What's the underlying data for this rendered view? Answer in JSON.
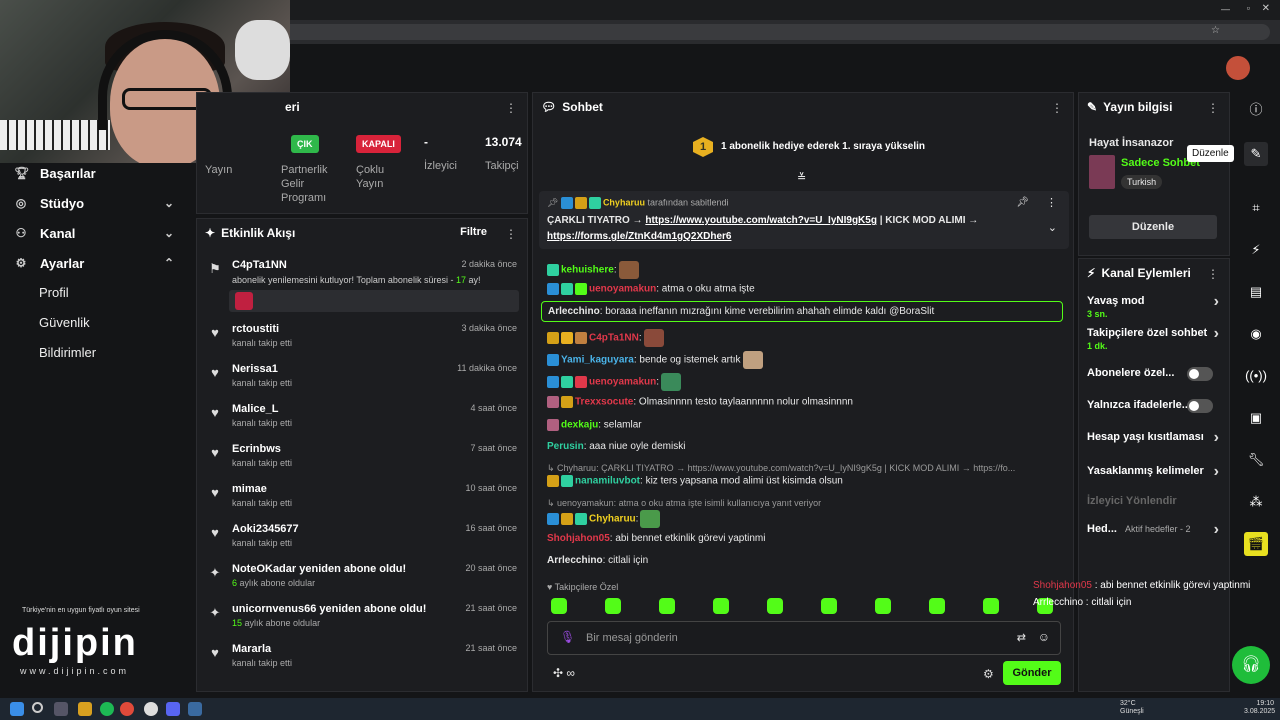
{
  "stats": {
    "header": "eri",
    "items": [
      {
        "tag": "ÇIK",
        "label": "Yayın"
      },
      {
        "tag": "",
        "label": "Partnerlik Gelir Programı"
      },
      {
        "tag": "KAPALI",
        "label": "Çoklu Yayın"
      },
      {
        "value": "-",
        "label": "İzleyici"
      },
      {
        "value": "13.074",
        "label": "Takipçi"
      }
    ]
  },
  "nav": {
    "items": [
      {
        "label": "Başarılar",
        "icon": "trophy-icon"
      },
      {
        "label": "Stüdyo",
        "icon": "studio-icon"
      },
      {
        "label": "Kanal",
        "icon": "channel-icon"
      },
      {
        "label": "Ayarlar",
        "icon": "gear-icon"
      }
    ],
    "sub": [
      "Profil",
      "Güvenlik",
      "Bildirimler"
    ]
  },
  "promo": {
    "tagline": "Türkiye'nin en uygun fiyatlı oyun sitesi",
    "logo": "dijipin",
    "url": "www.dijipin.com"
  },
  "activity": {
    "title": "Etkinlik Akışı",
    "filter": "Filtre",
    "items": [
      {
        "name": "C4pTa1NN",
        "sub": "abonelik yenilemesini kutluyor! Toplam abonelik süresi - ",
        "highlight": "17",
        "sub2": " ay!",
        "time": "2 dakika önce",
        "icon": "⚑"
      },
      {
        "name": "rctoustiti",
        "sub": "kanalı takip etti",
        "time": "3 dakika önce",
        "icon": "♥"
      },
      {
        "name": "Nerissa1",
        "sub": "kanalı takip etti",
        "time": "11 dakika önce",
        "icon": "♥"
      },
      {
        "name": "Malice_L",
        "sub": "kanalı takip etti",
        "time": "4 saat önce",
        "icon": "♥"
      },
      {
        "name": "Ecrinbws",
        "sub": "kanalı takip etti",
        "time": "7 saat önce",
        "icon": "♥"
      },
      {
        "name": "mimae",
        "sub": "kanalı takip etti",
        "time": "10 saat önce",
        "icon": "♥"
      },
      {
        "name": "Aoki2345677",
        "sub": "kanalı takip etti",
        "time": "16 saat önce",
        "icon": "♥"
      },
      {
        "name": "NoteOKadar yeniden abone oldu!",
        "highlight": "6",
        "sub": " aylık abone oldular",
        "time": "20 saat önce",
        "icon": "✦"
      },
      {
        "name": "unicornvenus66 yeniden abone oldu!",
        "highlight": "15",
        "sub": " aylık abone oldular",
        "time": "21 saat önce",
        "icon": "✦"
      },
      {
        "name": "Mararla",
        "sub": "kanalı takip etti",
        "time": "21 saat önce",
        "icon": "♥"
      }
    ]
  },
  "chat": {
    "title": "Sohbet",
    "gift_banner": "1 abonelik hediye ederek 1. sıraya yükselin",
    "gift_count": "1",
    "pinned": {
      "by_user": "Chyharuu",
      "by_text": "tarafından sabitlendi",
      "text1": "ÇARKLI TIYATRO → ",
      "link1": "https://www.youtube.com/watch?v=U_IyNI9gK5g",
      "text2": " | KICK MOD ALIMI →",
      "link2": "https://forms.gle/ZtnKd4m1gQ2XDher6"
    },
    "messages": [
      {
        "user": "kehuishere",
        "color": "#53fc18",
        "text": ":",
        "emote": true
      },
      {
        "user": "uenoyamakun",
        "color": "#e0384a",
        "text": ": atma o oku atma işte"
      },
      {
        "user": "Arlecchino",
        "color": "#e8e8e8",
        "text": ": boraaa ineffanın mızrağını kime verebilirim ahahah elimde kaldı @BoraSlit"
      },
      {
        "user": "C4pTa1NN",
        "color": "#e0384a",
        "text": ":",
        "emote": true
      },
      {
        "user": "Yami_kaguyara",
        "color": "#4ab3e8",
        "text": ": bende og istemek artık",
        "emote": true
      },
      {
        "user": "uenoyamakun",
        "color": "#e0384a",
        "text": ":",
        "emote": true
      },
      {
        "user": "Trexxsocute",
        "color": "#e0384a",
        "text": ": Olmasinnnn testo taylaannnnn nolur olmasinnnn"
      },
      {
        "user": "dexkaju",
        "color": "#53fc18",
        "text": ": selamlar"
      },
      {
        "user": "Perusin",
        "color": "#2fd0a0",
        "text": ": aaa niue oyle demiski"
      },
      {
        "user": "nanamiluvbot",
        "color": "#2fd0a0",
        "text": ": kiz ters yapsana mod alimi üst kisimda olsun"
      },
      {
        "user": "Chyharuu",
        "color": "#f0d020",
        "text": ":",
        "emote": true
      },
      {
        "user": "Shohjahon05",
        "color": "#e0384a",
        "text": ": abi bennet etkinlik görevi yaptinmi"
      },
      {
        "user": "Arrlecchino",
        "color": "#e8e8e8",
        "text": ": citlali için"
      }
    ],
    "reply1": "↳ Chyharuu: ÇARKLI TIYATRO → https://www.youtube.com/watch?v=U_IyNI9gK5g | KICK MOD ALIMI → https://fo...",
    "reply2": "↳ uenoyamakun: atma o oku atma işte isimli kullanıcıya yanıt veriyor",
    "followers_only": "♥ Takipçilere Özel",
    "input_placeholder": "Bir mesaj gönderin",
    "send": "Gönder"
  },
  "info": {
    "title": "Yayın bilgisi",
    "stream_title": "Hayat İnsanazor",
    "category": "Sadece Sohbet",
    "tag": "Turkish",
    "edit": "Düzenle",
    "tooltip": "Düzenle"
  },
  "actions": {
    "title": "Kanal Eylemleri",
    "rows": [
      {
        "label": "Yavaş mod",
        "sub": "3 sn."
      },
      {
        "label": "Takipçilere özel sohbet",
        "sub": "1 dk."
      },
      {
        "label": "Abonelere özel...",
        "toggle": true
      },
      {
        "label": "Yalnızca ifadelerle...",
        "toggle": true
      },
      {
        "label": "Hesap yaşı kısıtlaması"
      },
      {
        "label": "Yasaklanmış kelimeler"
      },
      {
        "label": "İzleyici Yönlendir",
        "dim": true
      },
      {
        "label": "Hed...",
        "extra": "Aktif hedefler - 2"
      }
    ]
  },
  "overlay": {
    "line1_user": "Shohjahon05",
    "line1_text": " : abi bennet etkinlik görevi yaptinmi",
    "line2_user": "Arrlecchino",
    "line2_text": " : citlali için"
  },
  "taskbar": {
    "weather": "32°C",
    "weather_sub": "Güneşli",
    "time": "19:10",
    "date": "3.08.2025"
  },
  "colors": {
    "accent": "#53fc18",
    "panel": "#1c1d20"
  }
}
